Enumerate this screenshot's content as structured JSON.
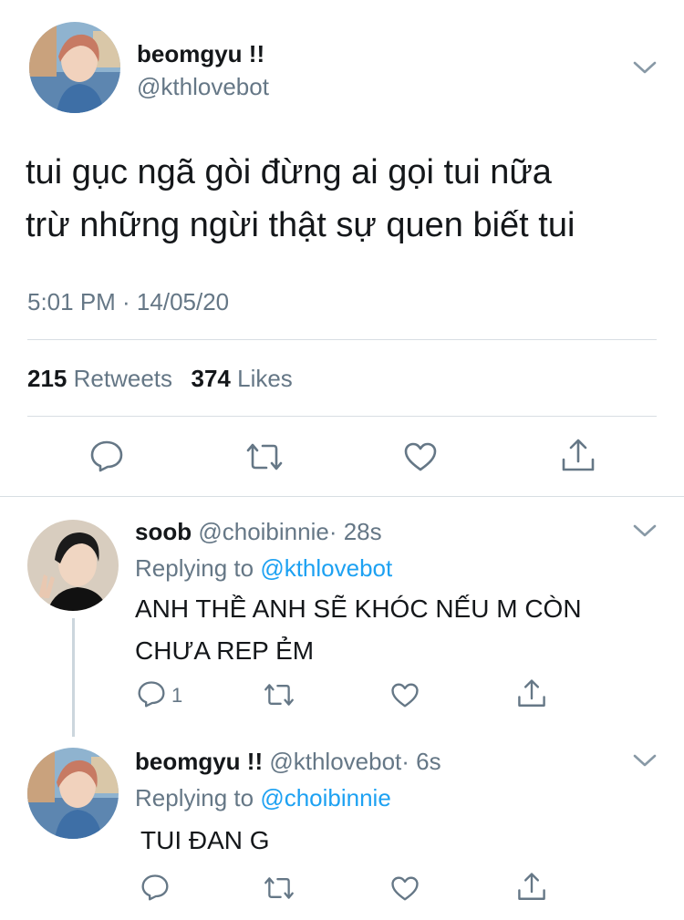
{
  "main_tweet": {
    "display_name": "beomgyu !!",
    "handle": "@kthlovebot",
    "text_line1": "tui gục ngã gòi đừng ai gọi tui nữa",
    "text_line2": "trừ những ngừi thật sự quen biết tui",
    "timestamp": "5:01 PM · 14/05/20",
    "retweets_count": "215",
    "retweets_label": "Retweets",
    "likes_count": "374",
    "likes_label": "Likes"
  },
  "reply1": {
    "display_name": "soob",
    "handle": "@choibinnie",
    "time": "· 28s",
    "replying_prefix": "Replying to",
    "replying_to": "@kthlovebot",
    "text_line1": "ANH THỀ ANH SẼ KHÓC NẾU M CÒN",
    "text_line2": "CHƯA REP ẺM",
    "reply_count": "1"
  },
  "reply2": {
    "display_name": "beomgyu !!",
    "handle": "@kthlovebot",
    "time": "· 6s",
    "replying_prefix": "Replying to",
    "replying_to": "@choibinnie",
    "text": "TUI ĐAN G"
  },
  "icons": {
    "reply": "reply-icon",
    "retweet": "retweet-icon",
    "like": "heart-icon",
    "share": "share-icon",
    "more": "chevron-down-icon"
  },
  "colors": {
    "link": "#1da1f2",
    "secondary_text": "#657786",
    "divider": "#d8dee3",
    "icon": "#657786"
  }
}
